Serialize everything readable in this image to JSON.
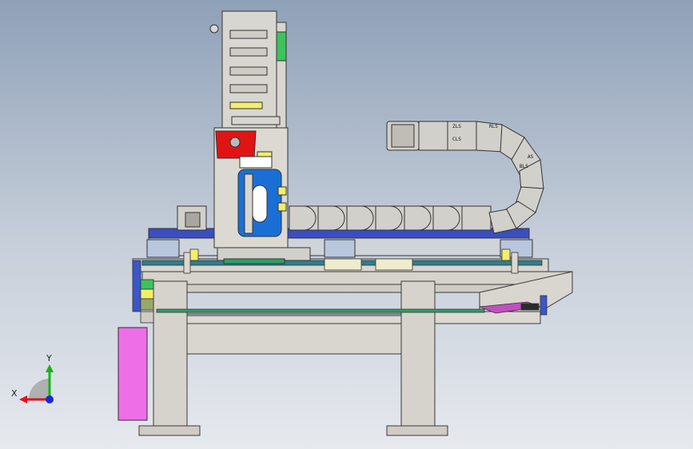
{
  "viewport": {
    "background_top": "#8fa1b8",
    "background_bottom": "#e6e9ee"
  },
  "triad": {
    "x_label": "X",
    "y_label": "Y",
    "x_color": "#e0141e",
    "y_color": "#14b414",
    "z_color": "#1428e0"
  },
  "colors": {
    "frame": "#d6d3cc",
    "frame_stroke": "#3a3a3a",
    "carriage_blue": "#1a6fd6",
    "beam_blue": "#3a4ec0",
    "bracket_red": "#e01414",
    "panel_magenta": "#ee6ee8",
    "accent_yellow": "#f3ee6a",
    "accent_green": "#3cc35c",
    "chain_gray": "#d2d0cb"
  },
  "chain_labels": [
    "ZLS",
    "RLS",
    "CLS",
    "BLS",
    "AS"
  ]
}
